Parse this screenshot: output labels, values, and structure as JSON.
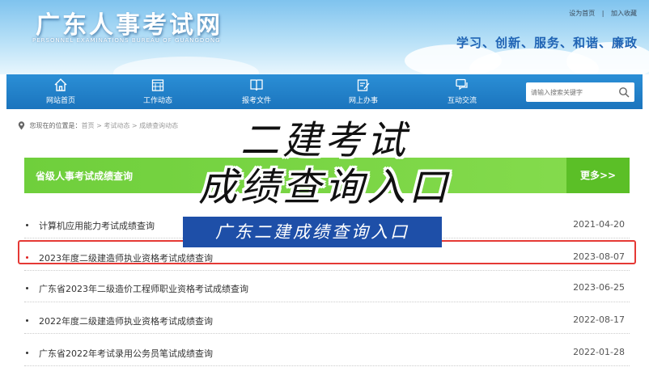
{
  "header": {
    "site_title": "广东人事考试网",
    "site_subtitle": "PERSONNEL EXAMINATIONS BUREAU OF GUANGDONG",
    "top_links": [
      "设为首页",
      "|",
      "加入收藏"
    ],
    "slogan": "学习、创新、服务、和谐、廉政"
  },
  "nav": {
    "items": [
      {
        "label": "网站首页",
        "icon": "home-icon"
      },
      {
        "label": "工作动态",
        "icon": "calendar-icon"
      },
      {
        "label": "报考文件",
        "icon": "book-icon"
      },
      {
        "label": "网上办事",
        "icon": "edit-icon"
      },
      {
        "label": "互动交流",
        "icon": "chat-icon"
      }
    ],
    "search_placeholder": "请输入搜索关键字"
  },
  "breadcrumb": {
    "prefix": "您现在的位置是：",
    "path": "首页 > 考试动态 > 成绩查询动态"
  },
  "section": {
    "title": "省级人事考试成绩查询",
    "more": "更多>>"
  },
  "list": [
    {
      "title": "计算机应用能力考试成绩查询",
      "date": "2021-04-20"
    },
    {
      "title": "2023年度二级建造师执业资格考试成绩查询",
      "date": "2023-08-07"
    },
    {
      "title": "广东省2023年二级造价工程师职业资格考试成绩查询",
      "date": "2023-06-25"
    },
    {
      "title": "2022年度二级建造师执业资格考试成绩查询",
      "date": "2022-08-17"
    },
    {
      "title": "广东省2022年考试录用公务员笔试成绩查询",
      "date": "2022-01-28"
    }
  ],
  "overlay": {
    "line1": "二建考试",
    "line2": "成绩查询入口",
    "banner": "广东二建成绩查询入口"
  },
  "colors": {
    "nav_blue": "#1b74bd",
    "section_green": "#6fcf3c",
    "highlight_red": "#e53935",
    "banner_blue": "#1e4fa8"
  }
}
